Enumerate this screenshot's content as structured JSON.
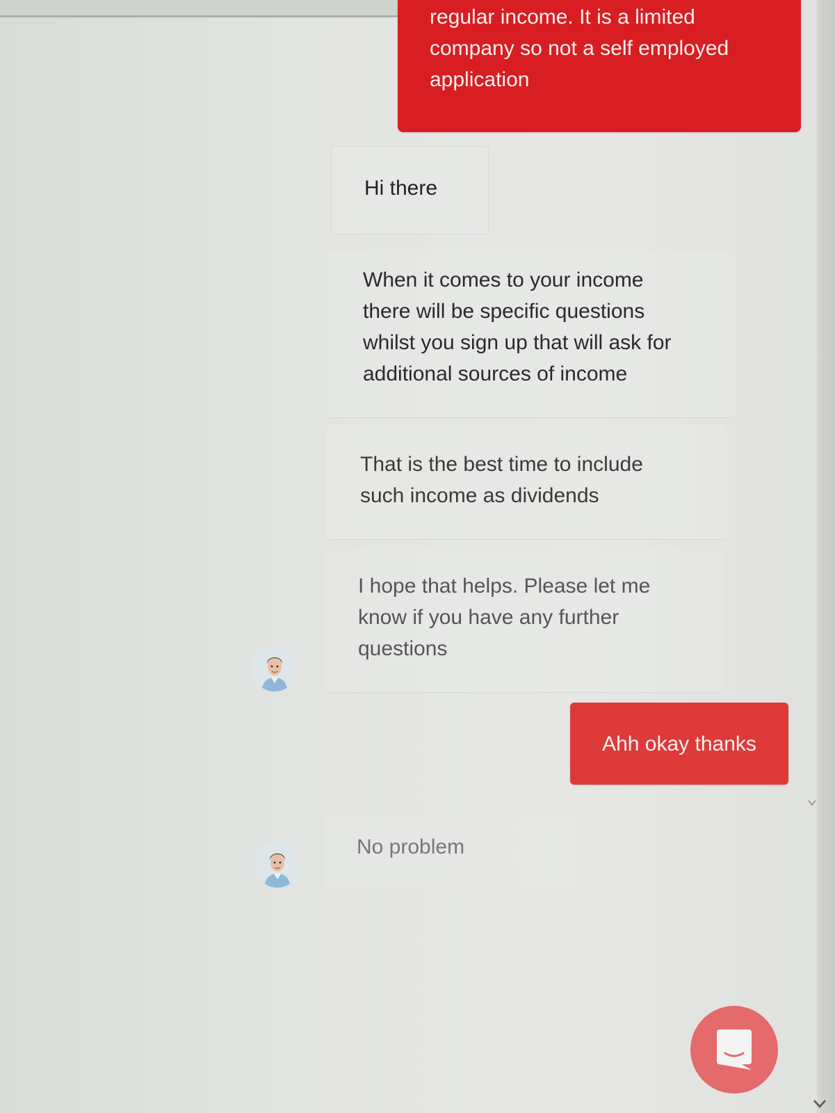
{
  "conversation": {
    "messages": [
      {
        "sender": "user",
        "lines": [
          "regular income. It is a limited",
          "company so not a self employed",
          "application"
        ]
      },
      {
        "sender": "agent",
        "lines": [
          "Hi there"
        ]
      },
      {
        "sender": "agent",
        "lines": [
          "When it comes to your income",
          "there will be specific questions",
          "whilst you sign up that will ask for",
          "additional sources of income"
        ]
      },
      {
        "sender": "agent",
        "lines": [
          "That is the best time to include",
          "such income as dividends"
        ]
      },
      {
        "sender": "agent",
        "lines": [
          "I hope that helps. Please let me",
          "know if you have any further",
          "questions"
        ]
      },
      {
        "sender": "user",
        "lines": [
          "Ahh okay thanks"
        ]
      },
      {
        "sender": "agent",
        "lines": [
          "No problem"
        ]
      }
    ]
  },
  "icons": {
    "agent_avatar": "agent-avatar-photo",
    "launcher": "chat-bubble-icon",
    "corner": "chevron-down-icon"
  },
  "colors": {
    "user_bubble": "#d81e22",
    "user_bubble_light": "#de3a3a",
    "launcher": "#e46a6c",
    "background": "#e2e4e1"
  }
}
